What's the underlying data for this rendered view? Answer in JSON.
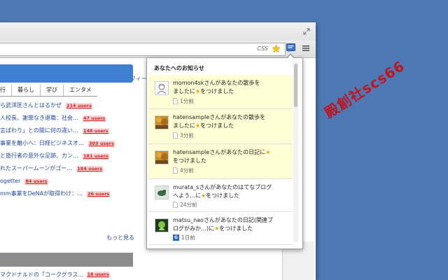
{
  "toolbar": {
    "css_label": "CSS",
    "menu_icon": "hamburger-menu-icon",
    "ext_icon": "hatena-notify-icon"
  },
  "page": {
    "profile_label": "プロフィー",
    "tabs": [
      "行",
      "暮らし",
      "学び",
      "エンタメ"
    ],
    "news": [
      {
        "title": "ら武洋匡さんとはるかぜ",
        "users": "214 users"
      },
      {
        "title": "人校長、謝罪なき退職：社会…",
        "users": "47 users"
      },
      {
        "title": "言ぱわり」との間に何の違い…",
        "users": "148 users"
      },
      {
        "title": "事業を離小へ：日経ビジネスオ…",
        "users": "303 users"
      },
      {
        "title": "と旅行者の意外な足跡、カン…",
        "users": "181 users"
      },
      {
        "title": "れたスーパームーンがゴー…",
        "users": "184 users"
      },
      {
        "title": "ogetter",
        "users": "84 users"
      },
      {
        "title": "mm事業をDeNAが取得わけ：…",
        "users": "26 users"
      }
    ],
    "more_label": "もっと見る",
    "bottom_item": {
      "title": "マクドナルドの「コークグラス…",
      "users": "18 users"
    }
  },
  "popup": {
    "header": "あなたへのお知らせ",
    "notifications": [
      {
        "line1": "momon4skさんがあなたの散歩を",
        "line2a": "ましたに",
        "line2b": "をつけました",
        "time": "1分前",
        "unread": true,
        "avatar": "sketch-avatar",
        "time_icon": "doc-icon"
      },
      {
        "line1": "hatensampleさんがあなたの散歩を",
        "line2a": "ましたに",
        "line2b": "をつけました",
        "time": "3分前",
        "unread": true,
        "avatar": "autumn-avatar",
        "time_icon": "doc-icon"
      },
      {
        "line1": "hatensampleさんがあなたの日記に",
        "line2a": "",
        "line2b": "をつけました",
        "time": "4分前",
        "unread": true,
        "avatar": "autumn-avatar",
        "time_icon": "doc-icon"
      },
      {
        "line1": "murata_sさんがあなたのはてなブログ",
        "line2a": "へよう…に",
        "line2b": "をつけました",
        "time": "24分前",
        "unread": false,
        "avatar": "bird-avatar",
        "time_icon": "doc-icon"
      },
      {
        "line1": "matsu_naoさんがあなたの日記(関連ブ",
        "line2a": "ログがみか…)に",
        "line2b": "をつけました",
        "time": "1日前",
        "unread": false,
        "avatar": "green-avatar",
        "time_icon": "g-icon"
      }
    ]
  },
  "watermark": "殿創社scs66",
  "colors": {
    "desktop": "#4f79b4",
    "unread_bg": "#fffed4",
    "users_red": "#d51e1e",
    "accent_blue": "#3f7fd2"
  }
}
